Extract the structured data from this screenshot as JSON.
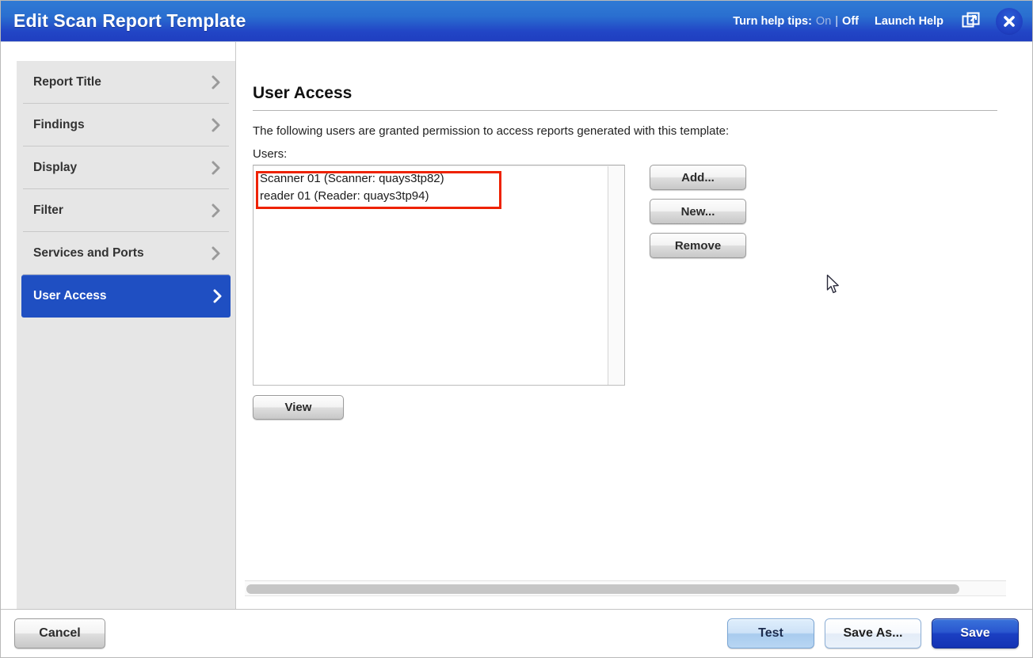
{
  "window": {
    "title": "Edit Scan Report Template",
    "help_tips_label": "Turn help tips:",
    "help_tips_on": "On",
    "help_tips_separator": "|",
    "help_tips_off": "Off",
    "launch_help": "Launch Help",
    "popout_icon": "popout-window-icon",
    "close_icon": "close-icon",
    "accent_color": "#1f4fc2",
    "titlebar_color": "#2a6fd0"
  },
  "sidebar": {
    "items": [
      {
        "label": "Report Title",
        "selected": false,
        "chevron": "chevron-right-icon"
      },
      {
        "label": "Findings",
        "selected": false,
        "chevron": "chevron-right-icon"
      },
      {
        "label": "Display",
        "selected": false,
        "chevron": "chevron-right-icon"
      },
      {
        "label": "Filter",
        "selected": false,
        "chevron": "chevron-right-icon"
      },
      {
        "label": "Services and Ports",
        "selected": false,
        "chevron": "chevron-right-icon"
      },
      {
        "label": "User Access",
        "selected": true,
        "chevron": "chevron-right-icon"
      }
    ]
  },
  "main": {
    "heading": "User Access",
    "description": "The following users are granted permission to access reports generated with this template:",
    "users_label": "Users:",
    "users": [
      "Scanner 01 (Scanner: quays3tp82)",
      "reader 01 (Reader: quays3tp94)"
    ],
    "highlight_color": "#ee2200",
    "buttons": {
      "add": "Add...",
      "new": "New...",
      "remove": "Remove",
      "view": "View"
    }
  },
  "footer": {
    "cancel": "Cancel",
    "test": "Test",
    "save_as": "Save As...",
    "save": "Save"
  }
}
